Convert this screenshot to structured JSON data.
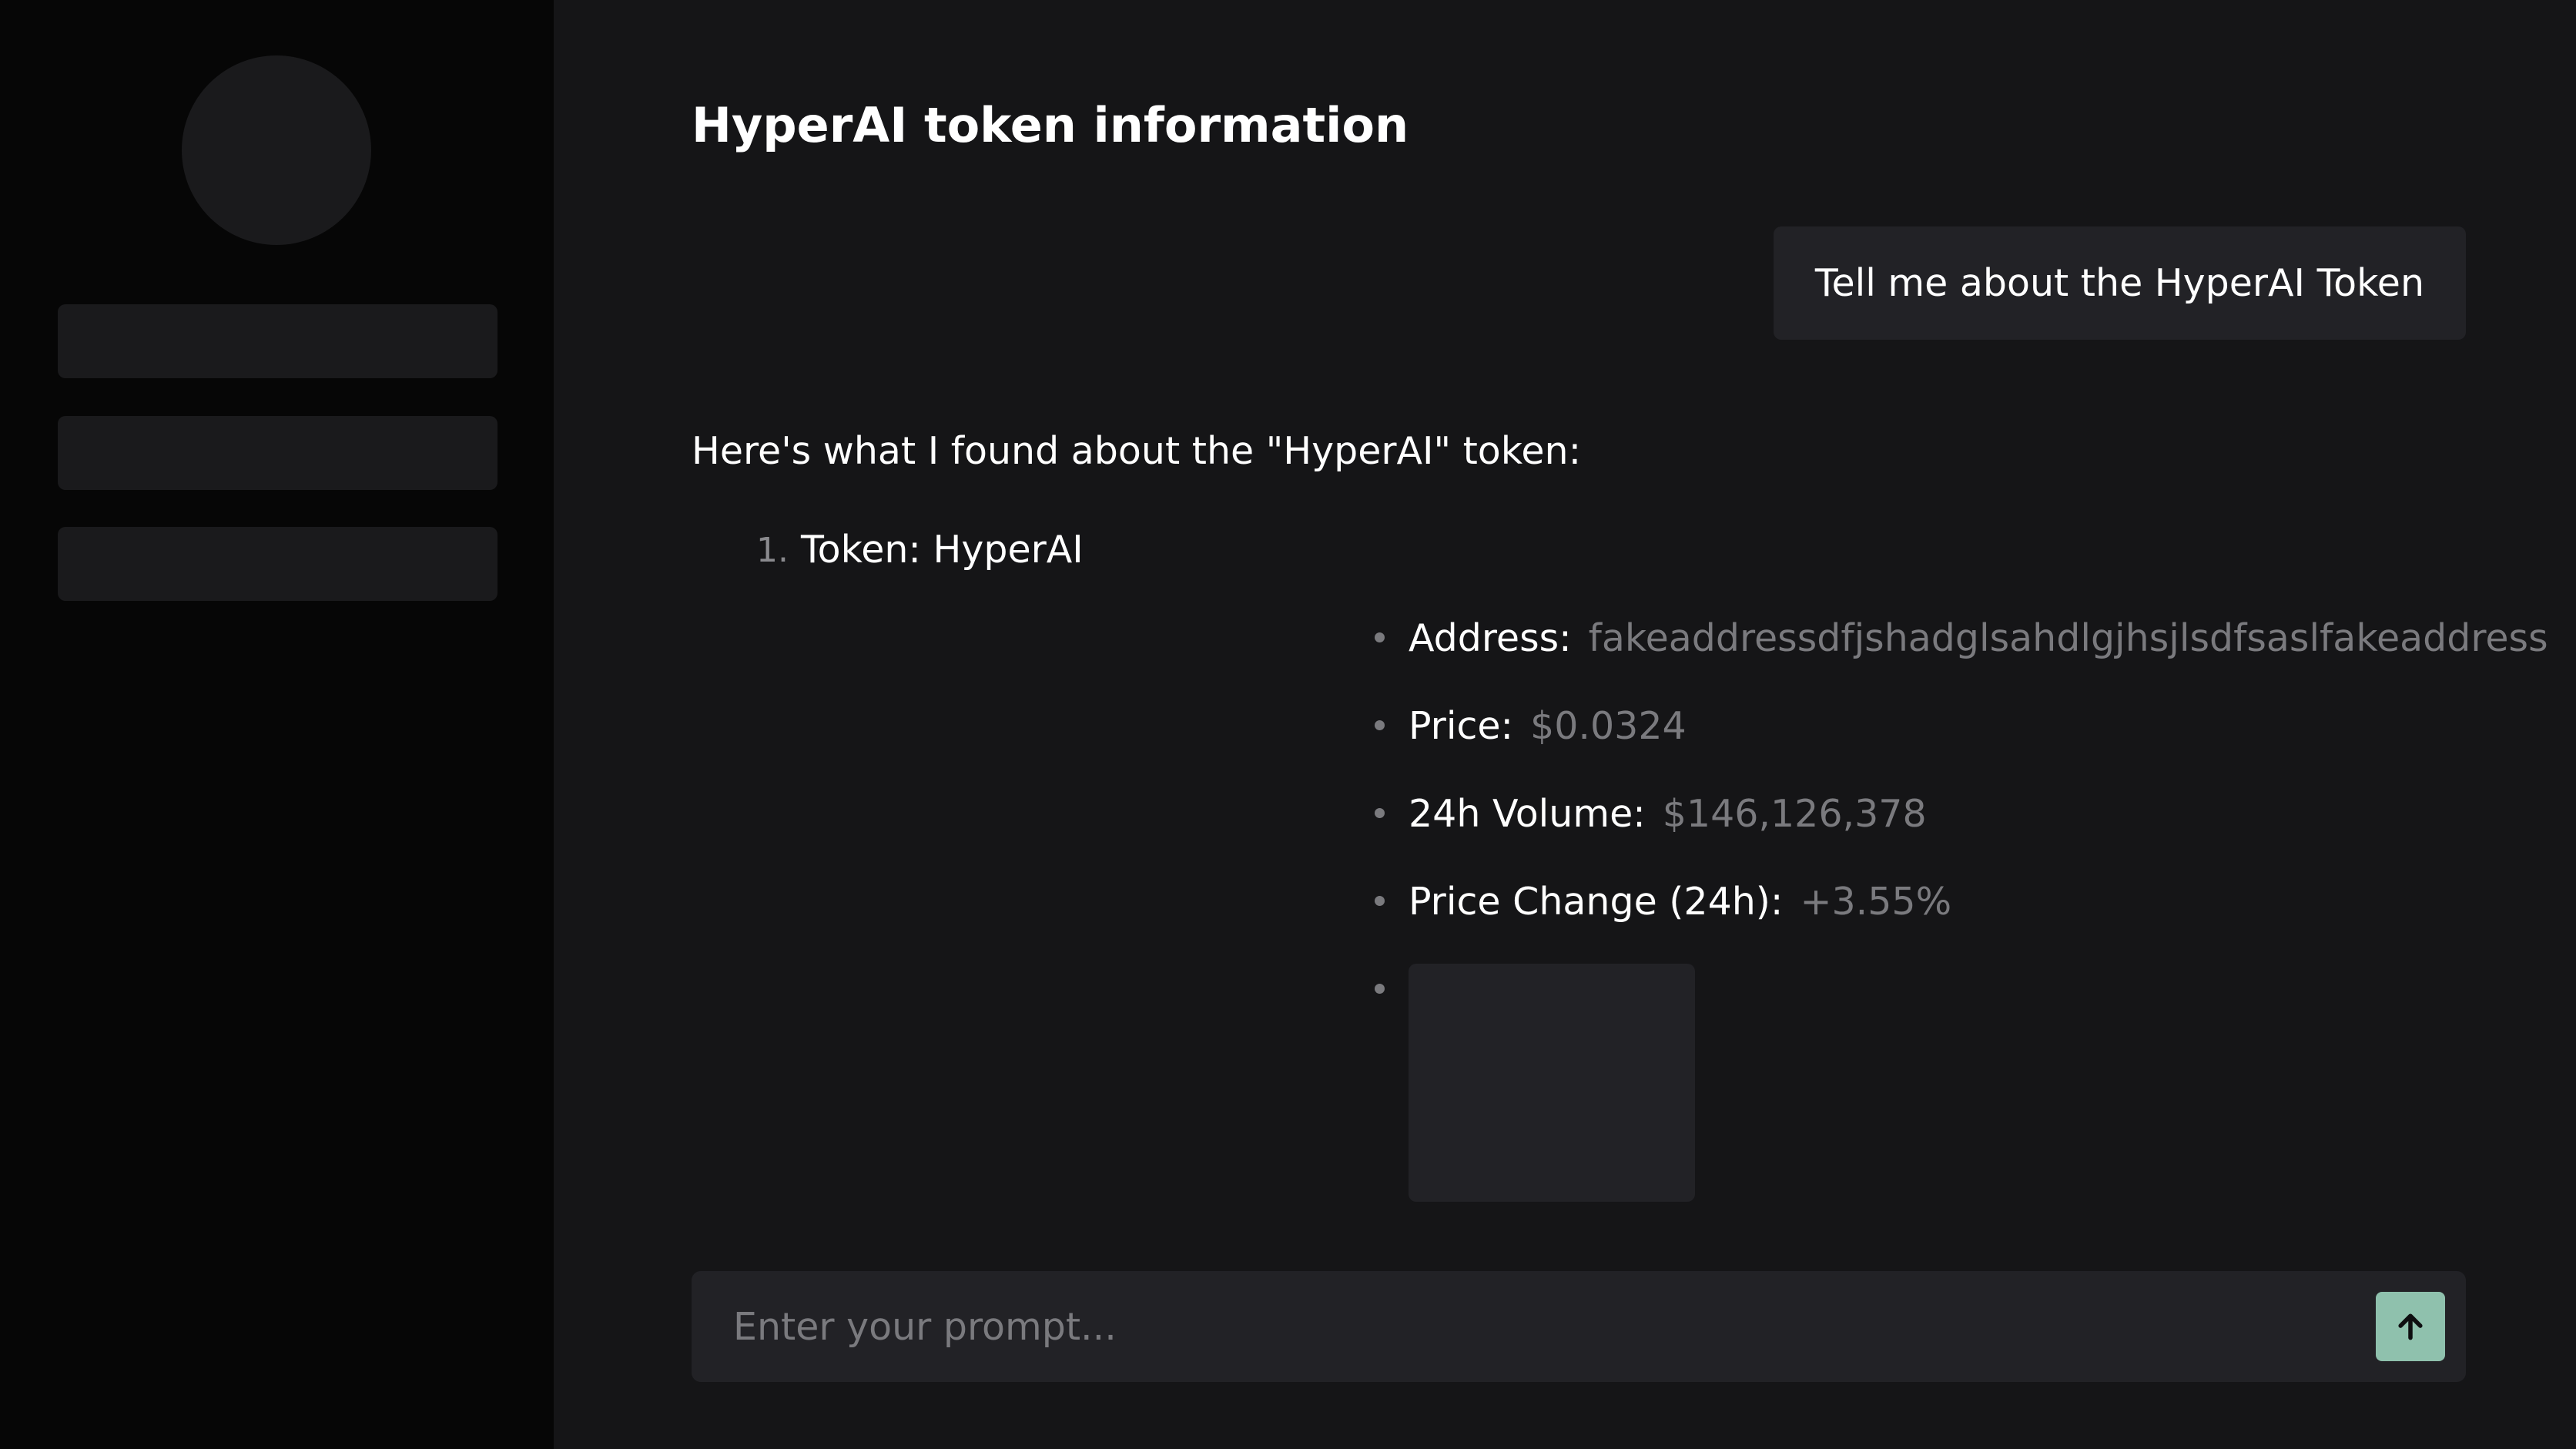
{
  "sidebar": {
    "nav_placeholders": 3
  },
  "header": {
    "title": "HyperAI token information"
  },
  "conversation": {
    "user_message": "Tell me about the HyperAI Token",
    "assistant_intro": "Here's what I found about the \"HyperAI\" token:",
    "list_number": "1.",
    "token_line": "Token: HyperAI",
    "details": [
      {
        "label": "Address:",
        "value": "fakeaddressdfjshadglsahdlgjhsjlsdfsaslfakeaddress"
      },
      {
        "label": "Price:",
        "value": "$0.0324"
      },
      {
        "label": "24h Volume:",
        "value": "$146,126,378"
      },
      {
        "label": "Price Change (24h):",
        "value": "+3.55%"
      }
    ]
  },
  "prompt": {
    "placeholder": "Enter your prompt...",
    "value": ""
  },
  "icons": {
    "send": "arrow-up-icon"
  },
  "colors": {
    "accent": "#8fc1ad",
    "background": "#151517",
    "sidebar": "#060606",
    "surface": "#222226",
    "muted_text": "#7a7a7e"
  }
}
